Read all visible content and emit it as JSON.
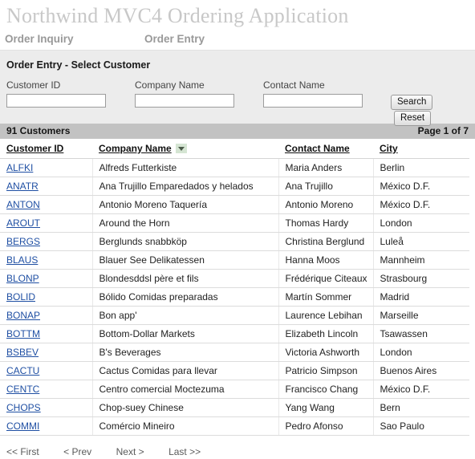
{
  "header": {
    "app_title": "Northwind MVC4 Ordering Application",
    "nav": [
      {
        "label": "Order Inquiry"
      },
      {
        "label": "Order Entry"
      }
    ]
  },
  "section": {
    "title": "Order Entry - Select Customer"
  },
  "search": {
    "fields": [
      {
        "label": "Customer ID",
        "value": "",
        "placeholder": ""
      },
      {
        "label": "Company Name",
        "value": "",
        "placeholder": ""
      },
      {
        "label": "Contact Name",
        "value": "",
        "placeholder": ""
      }
    ],
    "search_button": "Search",
    "reset_button": "Reset"
  },
  "results": {
    "count_label": "91 Customers",
    "page_label": "Page 1 of 7"
  },
  "table": {
    "columns": [
      {
        "label": "Customer ID",
        "sorted": false
      },
      {
        "label": "Company Name",
        "sorted": true,
        "sort_icon": "chevron-down-icon"
      },
      {
        "label": "Contact Name",
        "sorted": false
      },
      {
        "label": "City",
        "sorted": false
      }
    ],
    "rows": [
      {
        "id": "ALFKI",
        "company": "Alfreds Futterkiste",
        "contact": "Maria Anders",
        "city": "Berlin"
      },
      {
        "id": "ANATR",
        "company": "Ana Trujillo Emparedados y helados",
        "contact": "Ana Trujillo",
        "city": "México D.F."
      },
      {
        "id": "ANTON",
        "company": "Antonio Moreno Taquería",
        "contact": "Antonio Moreno",
        "city": "México D.F."
      },
      {
        "id": "AROUT",
        "company": "Around the Horn",
        "contact": "Thomas Hardy",
        "city": "London"
      },
      {
        "id": "BERGS",
        "company": "Berglunds snabbköp",
        "contact": "Christina Berglund",
        "city": "Luleå"
      },
      {
        "id": "BLAUS",
        "company": "Blauer See Delikatessen",
        "contact": "Hanna Moos",
        "city": "Mannheim"
      },
      {
        "id": "BLONP",
        "company": "Blondesddsl père et fils",
        "contact": "Frédérique Citeaux",
        "city": "Strasbourg"
      },
      {
        "id": "BOLID",
        "company": "Bólido Comidas preparadas",
        "contact": "Martín Sommer",
        "city": "Madrid"
      },
      {
        "id": "BONAP",
        "company": "Bon app'",
        "contact": "Laurence Lebihan",
        "city": "Marseille"
      },
      {
        "id": "BOTTM",
        "company": "Bottom-Dollar Markets",
        "contact": "Elizabeth Lincoln",
        "city": "Tsawassen"
      },
      {
        "id": "BSBEV",
        "company": "B's Beverages",
        "contact": "Victoria Ashworth",
        "city": "London"
      },
      {
        "id": "CACTU",
        "company": "Cactus Comidas para llevar",
        "contact": "Patricio Simpson",
        "city": "Buenos Aires"
      },
      {
        "id": "CENTC",
        "company": "Centro comercial Moctezuma",
        "contact": "Francisco Chang",
        "city": "México D.F."
      },
      {
        "id": "CHOPS",
        "company": "Chop-suey Chinese",
        "contact": "Yang Wang",
        "city": "Bern"
      },
      {
        "id": "COMMI",
        "company": "Comércio Mineiro",
        "contact": "Pedro Afonso",
        "city": "Sao Paulo"
      }
    ]
  },
  "pagination": {
    "links": [
      {
        "label": "<< First"
      },
      {
        "label": "< Prev"
      },
      {
        "label": "Next >"
      },
      {
        "label": "Last >>"
      }
    ]
  },
  "colors": {
    "title_gray": "#c8c8c8",
    "nav_gray": "#999999",
    "panel_bg": "#ececec",
    "results_bar": "#c2c2c2",
    "link_blue": "#1f4fa3",
    "sort_chip_green": "#d5e5d3"
  }
}
